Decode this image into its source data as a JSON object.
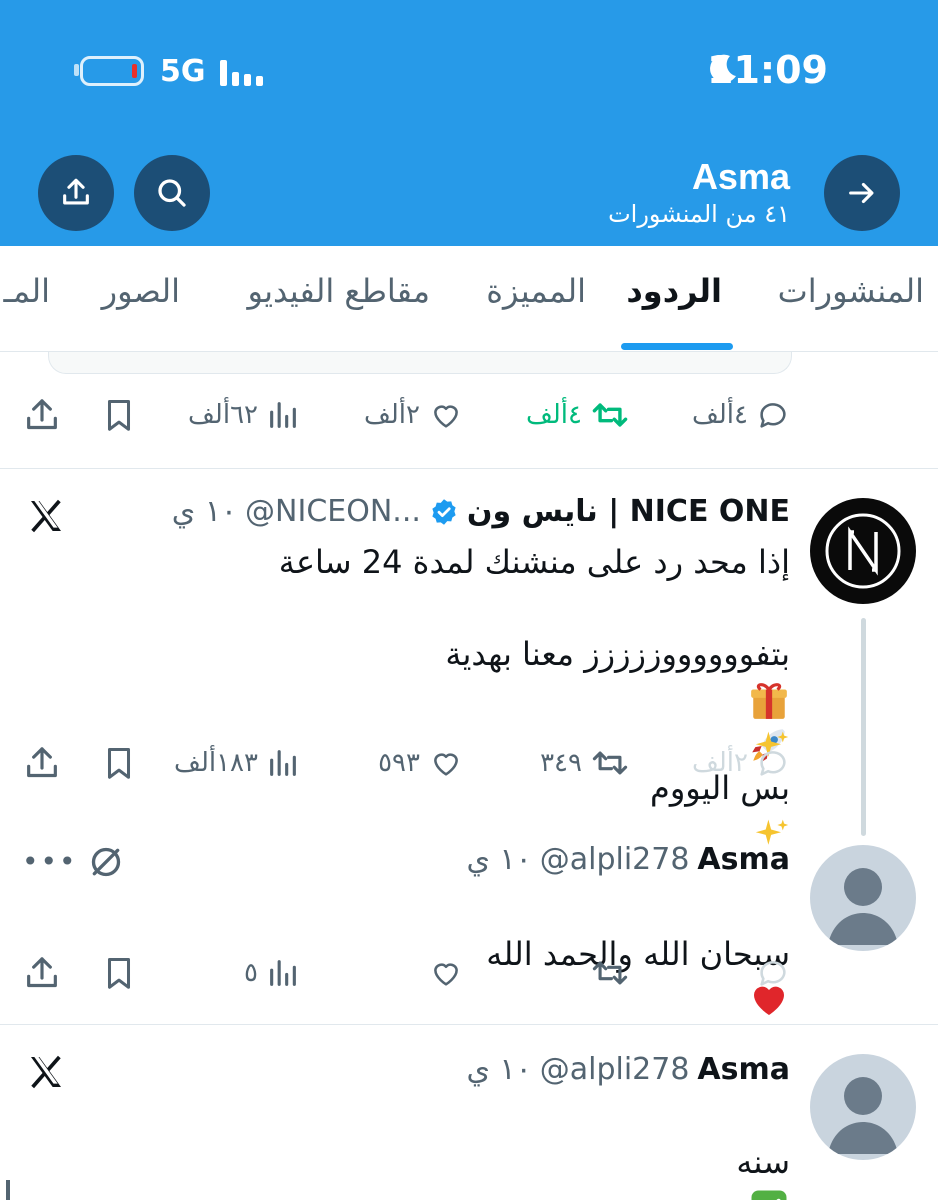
{
  "status_bar": {
    "time": "11:09",
    "network": "5G"
  },
  "header": {
    "profile_name": "Asma",
    "post_count": "٤١ من المنشورات"
  },
  "tabs": [
    {
      "label": "المنشورات",
      "active": false
    },
    {
      "label": "الردود",
      "active": true
    },
    {
      "label": "المميزة",
      "active": false
    },
    {
      "label": "مقاطع الفيديو",
      "active": false
    },
    {
      "label": "الصور",
      "active": false
    },
    {
      "label": "المـ",
      "active": false
    }
  ],
  "prev_post_actions": {
    "replies": "٤ألف",
    "reposts": "٤ألف",
    "likes": "٢ألف",
    "views": "٦٢ألف"
  },
  "post1": {
    "display_name": "نايس ون | NICE ONE",
    "handle": "@NICEON...",
    "time": "١٠ ي",
    "line1": "إذا محد رد على منشنك لمدة 24 ساعة",
    "line2": "بتفووووووززززز معنا بهدية",
    "line3": "بس اليووم",
    "actions": {
      "replies": "٢ألف",
      "reposts": "٣٤٩",
      "likes": "٥٩٣",
      "views": "١٨٣ألف"
    }
  },
  "reply1": {
    "display_name": "Asma",
    "handle": "@alpli278",
    "time": "١٠ ي",
    "text": "سبحان الله والحمد الله",
    "actions": {
      "views": "٥"
    }
  },
  "post2": {
    "display_name": "Asma",
    "handle": "@alpli278",
    "time": "١٠ ي",
    "text": "سنه"
  },
  "icons": {
    "verified": "verified-badge-icon",
    "x_logo": "x-logo-icon"
  },
  "colors": {
    "header_bg": "#279ae8",
    "accent": "#1d9bf0",
    "repost_active": "#00ba7c"
  }
}
